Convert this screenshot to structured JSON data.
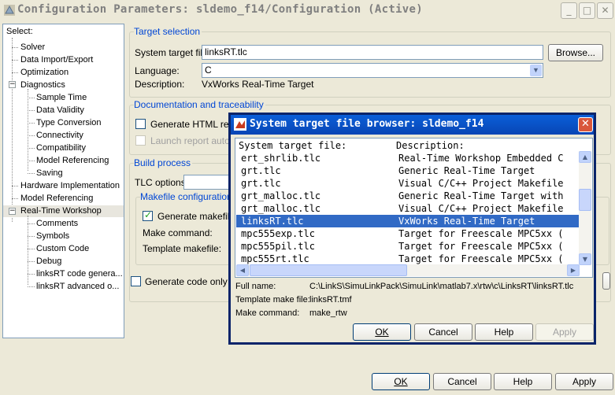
{
  "window": {
    "title": "Configuration Parameters: sldemo_f14/Configuration (Active)",
    "icon": "simulink-icon"
  },
  "tree": {
    "header": "Select:",
    "items": [
      {
        "label": "Solver"
      },
      {
        "label": "Data Import/Export"
      },
      {
        "label": "Optimization"
      },
      {
        "label": "Diagnostics"
      },
      {
        "label": "Sample Time"
      },
      {
        "label": "Data Validity"
      },
      {
        "label": "Type Conversion"
      },
      {
        "label": "Connectivity"
      },
      {
        "label": "Compatibility"
      },
      {
        "label": "Model Referencing"
      },
      {
        "label": "Saving"
      },
      {
        "label": "Hardware Implementation"
      },
      {
        "label": "Model Referencing"
      },
      {
        "label": "Real-Time Workshop"
      },
      {
        "label": "Comments"
      },
      {
        "label": "Symbols"
      },
      {
        "label": "Custom Code"
      },
      {
        "label": "Debug"
      },
      {
        "label": "linksRT code genera..."
      },
      {
        "label": "linksRT advanced o..."
      }
    ]
  },
  "target_selection": {
    "title": "Target selection",
    "system_target_label": "System target file:",
    "system_target_value": "linksRT.tlc",
    "browse_label": "Browse...",
    "language_label": "Language:",
    "language_value": "C",
    "description_label": "Description:",
    "description_value": "VxWorks Real-Time Target"
  },
  "documentation": {
    "title": "Documentation and traceability",
    "generate_html_label": "Generate HTML repo",
    "launch_report_label": "Launch report autom"
  },
  "build_process": {
    "title": "Build process",
    "tlc_options_label": "TLC options:",
    "makefile_title": "Makefile configuration",
    "generate_makefile_label": "Generate makefile",
    "make_command_label": "Make command:",
    "template_makefile_label": "Template makefile:",
    "generate_code_only_label": "Generate code only"
  },
  "main_buttons": {
    "ok": "OK",
    "cancel": "Cancel",
    "help": "Help",
    "apply": "Apply"
  },
  "dialog": {
    "title": "System target file browser: sldemo_f14",
    "col1_header": "System target file:",
    "col2_header": "Description:",
    "rows": [
      {
        "file": "ert_shrlib.tlc",
        "desc": "Real-Time Workshop Embedded C"
      },
      {
        "file": "grt.tlc",
        "desc": "Generic Real-Time Target"
      },
      {
        "file": "grt.tlc",
        "desc": "Visual C/C++ Project Makefile"
      },
      {
        "file": "grt_malloc.tlc",
        "desc": "Generic Real-Time Target with"
      },
      {
        "file": "grt_malloc.tlc",
        "desc": "Visual C/C++ Project Makefile"
      },
      {
        "file": "linksRT.tlc",
        "desc": "VxWorks Real-Time Target",
        "selected": true
      },
      {
        "file": "mpc555exp.tlc",
        "desc": "Target for Freescale MPC5xx ("
      },
      {
        "file": "mpc555pil.tlc",
        "desc": "Target for Freescale MPC5xx ("
      },
      {
        "file": "mpc555rt.tlc",
        "desc": "Target for Freescale MPC5xx ("
      }
    ],
    "full_name_label": "Full name:",
    "full_name_value": "C:\\LinkS\\SimuLinkPack\\SimuLink\\matlab7.x\\rtw\\c\\LinksRT\\linksRT.tlc",
    "template_make_label": "Template make file:",
    "template_make_value": "linksRT.tmf",
    "make_command_label": "Make command:",
    "make_command_value": "make_rtw",
    "ok": "OK",
    "cancel": "Cancel",
    "help": "Help",
    "apply": "Apply"
  }
}
